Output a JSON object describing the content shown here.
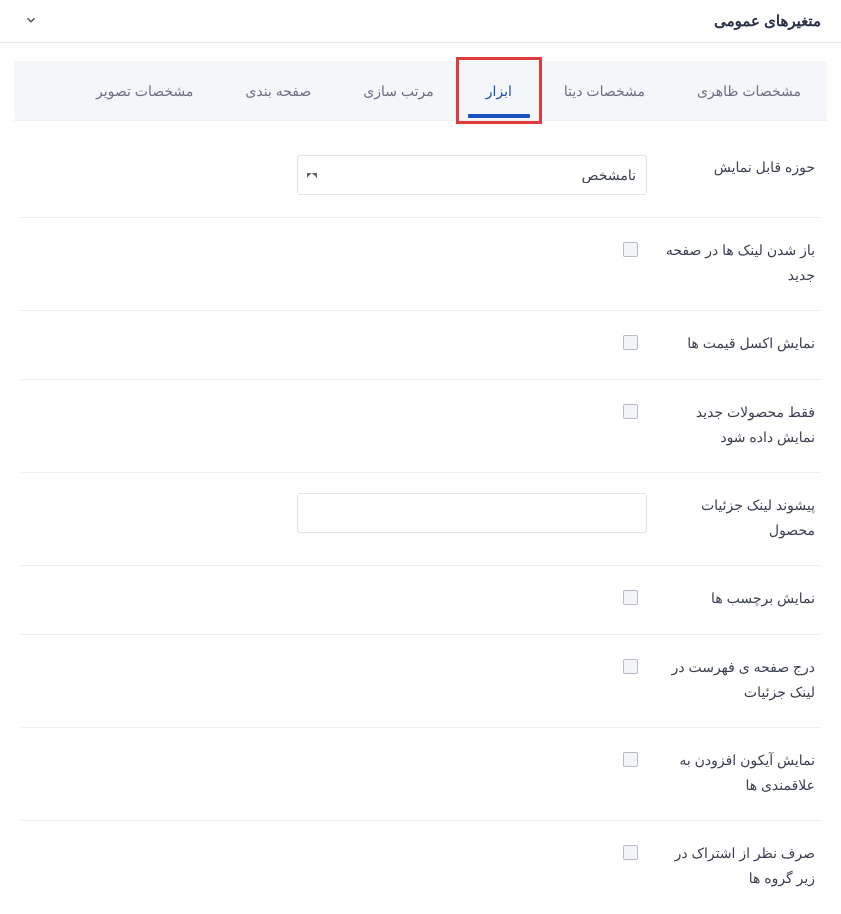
{
  "header": {
    "title": "متغیرهای عمومی"
  },
  "tabs": [
    {
      "label": "مشخصات ظاهری",
      "active": false
    },
    {
      "label": "مشخصات دیتا",
      "active": false
    },
    {
      "label": "ابزار",
      "active": true
    },
    {
      "label": "مرتب سازی",
      "active": false
    },
    {
      "label": "صفحه بندی",
      "active": false
    },
    {
      "label": "مشخصات تصویر",
      "active": false
    }
  ],
  "form": {
    "display_scope_label": "حوزه قابل نمایش",
    "display_scope_value": "نامشخص",
    "open_links_new_page_label": "باز شدن لینک ها در صفحه جدید",
    "open_links_new_page_value": false,
    "show_price_excel_label": "نمایش اکسل قیمت ها",
    "show_price_excel_value": false,
    "only_new_products_label": "فقط محصولات جدید نمایش داده شود",
    "only_new_products_value": false,
    "detail_link_prefix_label": "پیشوند لینک جزئیات محصول",
    "detail_link_prefix_value": "",
    "show_tags_label": "نمایش برچسب ها",
    "show_tags_value": false,
    "include_list_page_label": "درج صفحه ی فهرست در لینک جزئیات",
    "include_list_page_value": false,
    "show_wishlist_icon_label": "نمایش آیکون افزودن به علاقمندی ها",
    "show_wishlist_icon_value": false,
    "ignore_subgroup_share_label": "صرف نظر از اشتراک در زیر گروه ها",
    "ignore_subgroup_share_value": false
  },
  "colors": {
    "accent": "#1a4fbf",
    "highlight": "#e03a3a"
  }
}
